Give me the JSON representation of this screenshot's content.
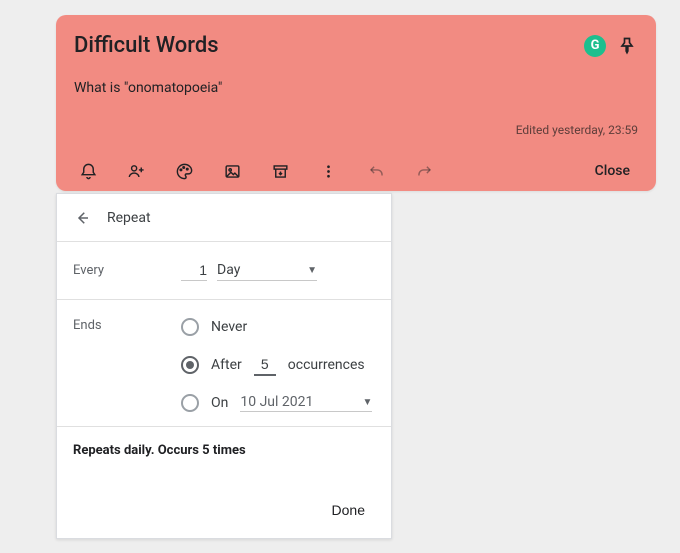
{
  "note": {
    "title": "Difficult Words",
    "body": "What is \"onomatopoeia\"",
    "edited": "Edited yesterday, 23:59",
    "g_badge": "G",
    "close_label": "Close"
  },
  "panel": {
    "title": "Repeat",
    "every_label": "Every",
    "every_value": "1",
    "every_unit": "Day",
    "ends_label": "Ends",
    "never_label": "Never",
    "after_label": "After",
    "after_value": "5",
    "occurrences_label": "occurrences",
    "on_label": "On",
    "on_date": "10 Jul 2021",
    "ends_selected": "after",
    "summary": "Repeats daily. Occurs 5 times",
    "done_label": "Done"
  }
}
